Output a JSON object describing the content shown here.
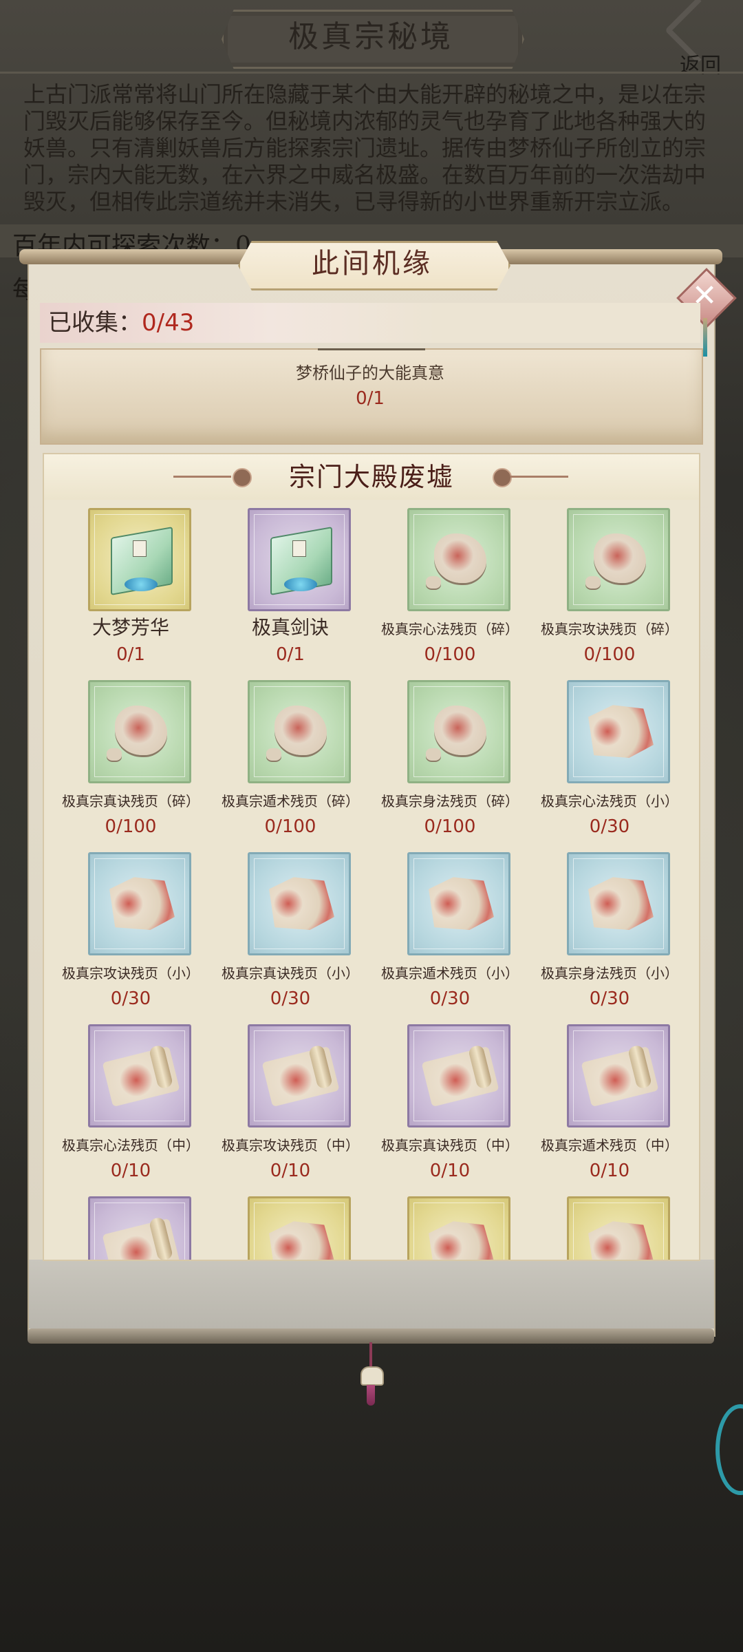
{
  "background_page": {
    "title": "极真宗秘境",
    "back_label": "返回",
    "description": "上古门派常常将山门所在隐藏于某个由大能开辟的秘境之中，是以在宗门毁灭后能够保存至今。但秘境内浓郁的灵气也孕育了此地各种强大的妖兽。只有清剿妖兽后方能探索宗门遗址。据传由梦桥仙子所创立的宗门，宗内大能无数，在六界之中威名极盛。在数百万年前的一次浩劫中毁灭，但相传此宗道统并未消失，已寻得新的小世界重新开宗立派。",
    "explore_count_label": "百年内可探索次数：0",
    "row2_label": "每"
  },
  "modal": {
    "title": "此间机缘",
    "collected_label": "已收集：",
    "collected_value": "0/43",
    "featured": {
      "name": "梦桥仙子的大能真意",
      "progress": "0/1"
    },
    "section": {
      "title": "宗门大殿废墟",
      "items": [
        {
          "name": "大梦芳华",
          "count": "0/1",
          "bg": "yellow",
          "art": "book"
        },
        {
          "name": "极真剑诀",
          "count": "0/1",
          "bg": "purple",
          "art": "book"
        },
        {
          "name": "极真宗心法残页（碎）",
          "count": "0/100",
          "bg": "green",
          "art": "fragment"
        },
        {
          "name": "极真宗攻诀残页（碎）",
          "count": "0/100",
          "bg": "green",
          "art": "fragment"
        },
        {
          "name": "极真宗真诀残页（碎）",
          "count": "0/100",
          "bg": "green",
          "art": "fragment"
        },
        {
          "name": "极真宗遁术残页（碎）",
          "count": "0/100",
          "bg": "green",
          "art": "fragment"
        },
        {
          "name": "极真宗身法残页（碎）",
          "count": "0/100",
          "bg": "green",
          "art": "fragment"
        },
        {
          "name": "极真宗心法残页（小）",
          "count": "0/30",
          "bg": "blue",
          "art": "page"
        },
        {
          "name": "极真宗攻诀残页（小）",
          "count": "0/30",
          "bg": "blue",
          "art": "page"
        },
        {
          "name": "极真宗真诀残页（小）",
          "count": "0/30",
          "bg": "blue",
          "art": "page"
        },
        {
          "name": "极真宗遁术残页（小）",
          "count": "0/30",
          "bg": "blue",
          "art": "page"
        },
        {
          "name": "极真宗身法残页（小）",
          "count": "0/30",
          "bg": "blue",
          "art": "page"
        },
        {
          "name": "极真宗心法残页（中）",
          "count": "0/10",
          "bg": "purple",
          "art": "scroll"
        },
        {
          "name": "极真宗攻诀残页（中）",
          "count": "0/10",
          "bg": "purple",
          "art": "scroll"
        },
        {
          "name": "极真宗真诀残页（中）",
          "count": "0/10",
          "bg": "purple",
          "art": "scroll"
        },
        {
          "name": "极真宗遁术残页（中）",
          "count": "0/10",
          "bg": "purple",
          "art": "scroll"
        },
        {
          "name": "",
          "count": "",
          "bg": "purple",
          "art": "scroll"
        },
        {
          "name": "",
          "count": "",
          "bg": "yellow",
          "art": "page"
        },
        {
          "name": "",
          "count": "",
          "bg": "yellow",
          "art": "page"
        },
        {
          "name": "",
          "count": "",
          "bg": "yellow",
          "art": "page"
        }
      ]
    }
  },
  "colors": {
    "accent_red": "#9a2a1e",
    "title_brown": "#4a1e18",
    "panel_bg": "#e6dfcf"
  }
}
